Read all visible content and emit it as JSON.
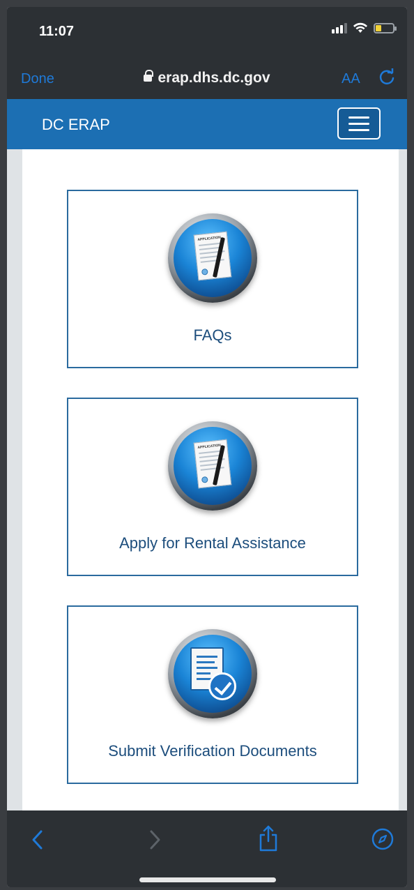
{
  "status_bar": {
    "time": "11:07"
  },
  "browser": {
    "done_label": "Done",
    "url": "erap.dhs.dc.gov",
    "text_size_label": "AA"
  },
  "site": {
    "title": "DC ERAP"
  },
  "cards": [
    {
      "label": "FAQs",
      "icon": "application-document-icon",
      "doc_title": "APPLICATION"
    },
    {
      "label": "Apply for Rental Assistance",
      "icon": "application-document-icon",
      "doc_title": "APPLICATION"
    },
    {
      "label": "Submit Verification Documents",
      "icon": "document-check-icon"
    }
  ],
  "colors": {
    "nav_blue": "#1c6fb3",
    "link_blue": "#1f7ad8",
    "card_border": "#2a6a9e",
    "chrome_dark": "#2c3034"
  }
}
